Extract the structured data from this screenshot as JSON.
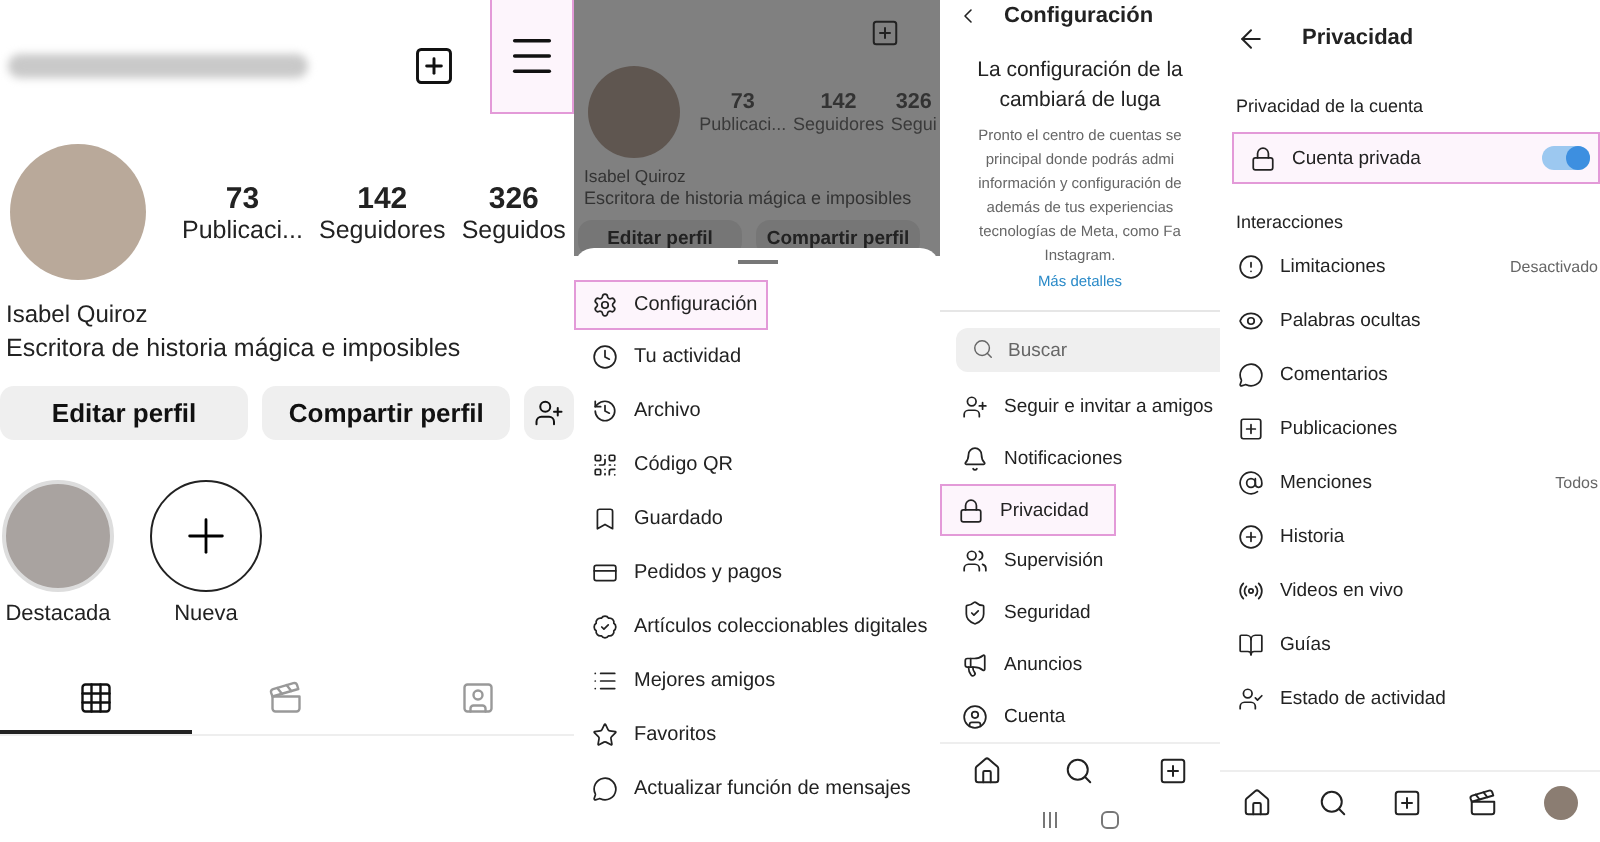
{
  "profile": {
    "menu_highlighted": true,
    "stats": [
      {
        "value": "73",
        "label": "Publicaci..."
      },
      {
        "value": "142",
        "label": "Seguidores"
      },
      {
        "value": "326",
        "label": "Seguidos"
      }
    ],
    "name": "Isabel Quiroz",
    "bio": "Escritora de historia mágica e imposibles",
    "buttons": [
      "Editar perfil",
      "Compartir perfil"
    ],
    "highlights": [
      {
        "label": "Destacada",
        "kind": "photo"
      },
      {
        "label": "Nueva",
        "kind": "new"
      }
    ],
    "tabs": [
      {
        "selected": true
      },
      {
        "selected": false
      },
      {
        "selected": false
      }
    ]
  },
  "menu_sheet": {
    "background": {
      "stats": [
        {
          "value": "73",
          "label": "Publicaci..."
        },
        {
          "value": "142",
          "label": "Seguidores"
        },
        {
          "value": "326",
          "label": "Segui"
        }
      ],
      "name": "Isabel Quiroz",
      "bio": "Escritora de historia mágica e imposibles",
      "buttons": [
        "Editar perfil",
        "Compartir perfil"
      ]
    },
    "items": [
      {
        "label": "Configuración",
        "highlighted": true
      },
      {
        "label": "Tu actividad",
        "highlighted": false
      },
      {
        "label": "Archivo",
        "highlighted": false
      },
      {
        "label": "Código QR",
        "highlighted": false
      },
      {
        "label": "Guardado",
        "highlighted": false
      },
      {
        "label": "Pedidos y pagos",
        "highlighted": false
      },
      {
        "label": "Artículos coleccionables digitales",
        "highlighted": false
      },
      {
        "label": "Mejores amigos",
        "highlighted": false
      },
      {
        "label": "Favoritos",
        "highlighted": false
      },
      {
        "label": "Actualizar función de mensajes",
        "highlighted": false
      }
    ]
  },
  "settings": {
    "title": "Configuración",
    "notice": {
      "title_lines": [
        "La configuración de la",
        "cambiará de luga"
      ],
      "body_lines": [
        "Pronto el centro de cuentas se",
        "principal donde podrás admi",
        "información y configuración de",
        "además de tus experiencias",
        "tecnologías de Meta, como Fa",
        "Instagram."
      ],
      "link": "Más detalles"
    },
    "search": {
      "placeholder": "Buscar"
    },
    "items": [
      {
        "label": "Seguir e invitar a amigos",
        "highlighted": false
      },
      {
        "label": "Notificaciones",
        "highlighted": false
      },
      {
        "label": "Privacidad",
        "highlighted": true
      },
      {
        "label": "Supervisión",
        "highlighted": false
      },
      {
        "label": "Seguridad",
        "highlighted": false
      },
      {
        "label": "Anuncios",
        "highlighted": false
      },
      {
        "label": "Cuenta",
        "highlighted": false
      }
    ]
  },
  "privacy": {
    "title": "Privacidad",
    "account_section": "Privacidad de la cuenta",
    "private_account": {
      "label": "Cuenta privada",
      "on": true,
      "highlighted": true
    },
    "interactions_section": "Interacciones",
    "items": [
      {
        "label": "Limitaciones",
        "value": "Desactivado"
      },
      {
        "label": "Palabras ocultas"
      },
      {
        "label": "Comentarios"
      },
      {
        "label": "Publicaciones"
      },
      {
        "label": "Menciones",
        "value": "Todos"
      },
      {
        "label": "Historia"
      },
      {
        "label": "Videos en vivo"
      },
      {
        "label": "Guías"
      },
      {
        "label": "Estado de actividad"
      }
    ]
  }
}
